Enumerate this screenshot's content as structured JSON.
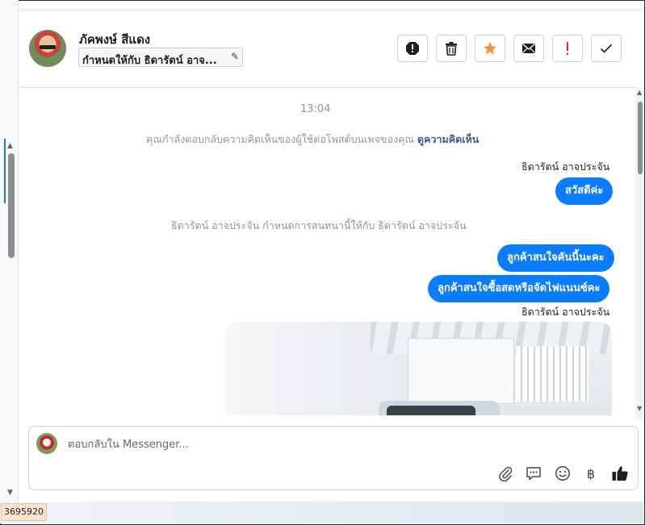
{
  "header": {
    "contact_name": "ภัคพงษ์ สีแดง",
    "assign_text": "กำหนดให้กับ ธิดารัตน์ อาจ...",
    "toolbar": {
      "spam_icon": "alert-octagon-icon",
      "delete_icon": "trash-icon",
      "star_icon": "star-icon",
      "unread_icon": "envelope-icon",
      "important_icon": "exclamation-icon",
      "done_icon": "check-icon"
    }
  },
  "conversation": {
    "timestamp": "13:04",
    "system_notice": "คุณกำลังตอบกลับความคิดเห็นของผู้ใช้ต่อโพสต์บนเพจของคุณ",
    "system_notice_link": "ดูความคิดเห็น",
    "sender_1": "ธิดารัตน์ อาจประจัน",
    "message_1": "สวัสดีค่ะ",
    "assign_notice": "ธิดารัตน์ อาจประจัน กำหนดการสนทนานี้ให้กับ ธิดารัตน์ อาจประจัน",
    "message_2": "ลูกค้าสนใจคันนี้นะคะ",
    "message_3": "ลูกค้าสนใจซื้อสดหรือจัดไฟแนนซ์คะ",
    "sender_2": "ธิดารัตน์ อาจประจัน"
  },
  "reply": {
    "placeholder": "ตอบกลับใน Messenger...",
    "icons": [
      "paperclip-icon",
      "chat-bubble-icon",
      "smiley-icon",
      "baht-icon",
      "thumbs-up-icon"
    ],
    "baht_symbol": "฿"
  },
  "footer": {
    "id_tag": "3695920"
  },
  "colors": {
    "bubble": "#0a7cff",
    "star": "#f7923b",
    "important": "#e41e3f",
    "link": "#385898"
  }
}
